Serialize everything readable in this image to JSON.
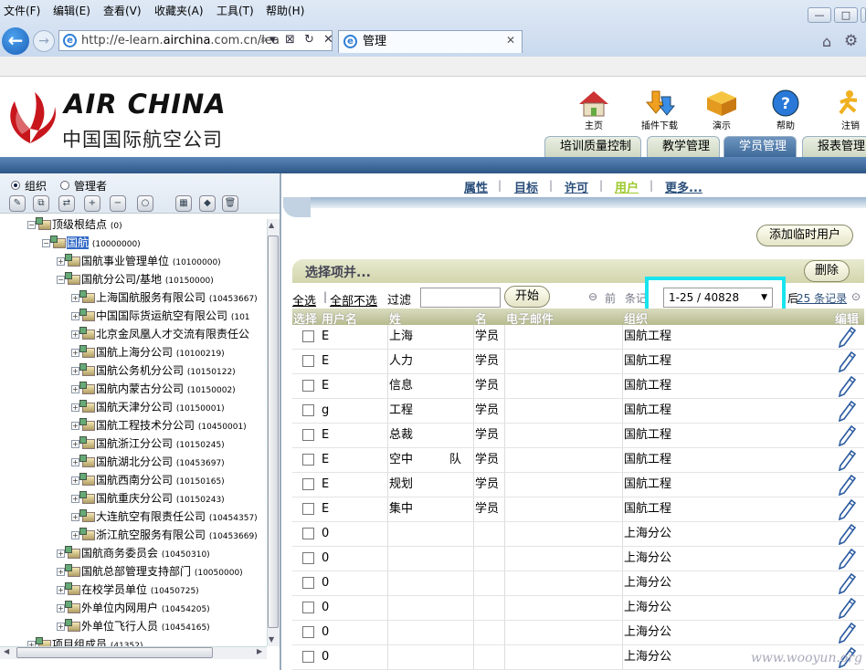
{
  "browser": {
    "url_prefix": "http://e-learn.",
    "url_host": "airchina",
    "url_suffix": ".com.cn/lea",
    "tab_title": "管理",
    "win_min": "—",
    "win_max": "□",
    "win_close": "✕",
    "menus": [
      "文件(F)",
      "编辑(E)",
      "查看(V)",
      "收藏夹(A)",
      "工具(T)",
      "帮助(H)"
    ]
  },
  "header": {
    "logo_en": "AIR CHINA",
    "logo_cn": "中国国际航空公司",
    "top_icons": [
      {
        "label": "主页",
        "icon": "home-icon"
      },
      {
        "label": "插件下载",
        "icon": "download-icon"
      },
      {
        "label": "演示",
        "icon": "demo-icon"
      },
      {
        "label": "帮助",
        "icon": "help-icon"
      },
      {
        "label": "注销",
        "icon": "logout-icon"
      }
    ],
    "nav_tabs": [
      "培训质量控制",
      "教学管理",
      "学员管理",
      "报表管理"
    ]
  },
  "left": {
    "radio_org": "组织",
    "radio_admin": "管理者",
    "tree": [
      {
        "label": "顶级根结点",
        "code": "(0)",
        "level": 0,
        "toggle": "−"
      },
      {
        "label": "国航",
        "code": "(10000000)",
        "level": 1,
        "toggle": "−",
        "selected": true
      },
      {
        "label": "国航事业管理单位",
        "code": "(10100000)",
        "level": 2,
        "toggle": "+"
      },
      {
        "label": "国航分公司/基地",
        "code": "(10150000)",
        "level": 2,
        "toggle": "−"
      },
      {
        "label": "上海国航服务有限公司",
        "code": "(10453667)",
        "level": 3,
        "toggle": "+"
      },
      {
        "label": "中国国际货运航空有限公司",
        "code": "(101",
        "level": 3,
        "toggle": "+"
      },
      {
        "label": "北京金凤凰人才交流有限责任公",
        "code": "",
        "level": 3,
        "toggle": "+"
      },
      {
        "label": "国航上海分公司",
        "code": "(10100219)",
        "level": 3,
        "toggle": "+"
      },
      {
        "label": "国航公务机分公司",
        "code": "(10150122)",
        "level": 3,
        "toggle": "+"
      },
      {
        "label": "国航内蒙古分公司",
        "code": "(10150002)",
        "level": 3,
        "toggle": "+"
      },
      {
        "label": "国航天津分公司",
        "code": "(10150001)",
        "level": 3,
        "toggle": "+"
      },
      {
        "label": "国航工程技术分公司",
        "code": "(10450001)",
        "level": 3,
        "toggle": "+"
      },
      {
        "label": "国航浙江分公司",
        "code": "(10150245)",
        "level": 3,
        "toggle": "+"
      },
      {
        "label": "国航湖北分公司",
        "code": "(10453697)",
        "level": 3,
        "toggle": "+"
      },
      {
        "label": "国航西南分公司",
        "code": "(10150165)",
        "level": 3,
        "toggle": "+"
      },
      {
        "label": "国航重庆分公司",
        "code": "(10150243)",
        "level": 3,
        "toggle": "+"
      },
      {
        "label": "大连航空有限责任公司",
        "code": "(10454357)",
        "level": 3,
        "toggle": "+"
      },
      {
        "label": "浙江航空服务有限公司",
        "code": "(10453669)",
        "level": 3,
        "toggle": "+"
      },
      {
        "label": "国航商务委员会",
        "code": "(10450310)",
        "level": 2,
        "toggle": "+"
      },
      {
        "label": "国航总部管理支持部门",
        "code": "(10050000)",
        "level": 2,
        "toggle": "+"
      },
      {
        "label": "在校学员单位",
        "code": "(10450725)",
        "level": 2,
        "toggle": "+"
      },
      {
        "label": "外单位内网用户",
        "code": "(10454205)",
        "level": 2,
        "toggle": "+"
      },
      {
        "label": "外单位飞行人员",
        "code": "(10454165)",
        "level": 2,
        "toggle": "+"
      },
      {
        "label": "项目组成员",
        "code": "(41352)",
        "level": 0,
        "toggle": "+"
      }
    ]
  },
  "right": {
    "tabs": [
      "属性",
      "目标",
      "许可",
      "用户",
      "更多..."
    ],
    "add_temp_user": "添加临时用户",
    "merge_title": "选择项并...",
    "delete": "删除",
    "select_all": "全选",
    "deselect_all": "全部不选",
    "filter_label": "过滤",
    "filter_value": "",
    "start": "开始",
    "prev": "前",
    "records_label": "条记录",
    "page_range": "1-25 / 40828",
    "next_prefix": "后",
    "next_count": "25 条记录",
    "columns": [
      "选择",
      "用户名",
      "姓",
      "名",
      "电子邮件",
      "组织",
      "编辑"
    ],
    "rows": [
      {
        "username": "E",
        "surname": "上海",
        "given": "学员",
        "email": "",
        "org": "国航工程"
      },
      {
        "username": "E",
        "surname": "人力",
        "given": "学员",
        "email": "",
        "org": "国航工程"
      },
      {
        "username": "E",
        "surname": "信息",
        "given": "学员",
        "email": "",
        "org": "国航工程"
      },
      {
        "username": "g",
        "surname": "工程",
        "given": "学员",
        "email": "",
        "org": "国航工程"
      },
      {
        "username": "E",
        "surname": "总裁",
        "given": "学员",
        "email": "",
        "org": "国航工程"
      },
      {
        "username": "E",
        "surname": "空中",
        "extra": "队",
        "given": "学员",
        "email": "",
        "org": "国航工程"
      },
      {
        "username": "E",
        "surname": "规划",
        "given": "学员",
        "email": "",
        "org": "国航工程"
      },
      {
        "username": "E",
        "surname": "集中",
        "given": "学员",
        "email": "",
        "org": "国航工程"
      },
      {
        "username": "0",
        "surname": "",
        "given": "",
        "email": "",
        "org": "上海分公"
      },
      {
        "username": "0",
        "surname": "",
        "given": "",
        "email": "",
        "org": "上海分公"
      },
      {
        "username": "0",
        "surname": "",
        "given": "",
        "email": "",
        "org": "上海分公"
      },
      {
        "username": "0",
        "surname": "",
        "given": "",
        "email": "",
        "org": "上海分公"
      },
      {
        "username": "0",
        "surname": "",
        "given": "",
        "email": "",
        "org": "上海分公"
      },
      {
        "username": "0",
        "surname": "",
        "given": "",
        "email": "",
        "org": "上海分公"
      }
    ]
  },
  "watermark": "www.wooyun.org"
}
